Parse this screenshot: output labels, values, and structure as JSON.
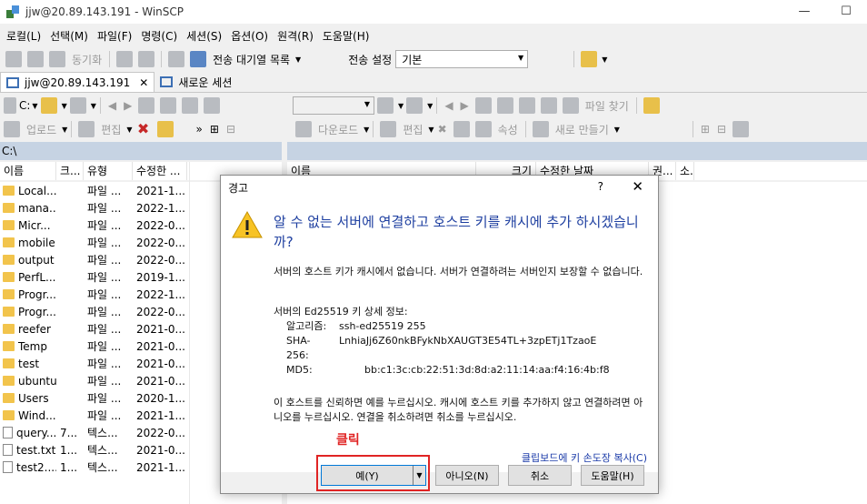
{
  "window": {
    "title": "jjw@20.89.143.191 - WinSCP",
    "minimize_glyph": "—",
    "maximize_glyph": "☐",
    "close_glyph": "✕"
  },
  "menu": [
    "로컬(L)",
    "선택(M)",
    "파일(F)",
    "명령(C)",
    "세션(S)",
    "옵션(O)",
    "원격(R)",
    "도움말(H)"
  ],
  "toolbar1": {
    "sync_label": "동기화",
    "queue_label": "전송 대기열 목록",
    "transfer_settings_label": "전송 설정",
    "transfer_settings_value": "기본"
  },
  "tabs": [
    {
      "label": "jjw@20.89.143.191",
      "close": "✕"
    },
    {
      "label": "새로운 세션"
    }
  ],
  "local_toolbar": {
    "drive": "C:",
    "upload_label": "업로드",
    "edit_label": "편집"
  },
  "remote_toolbar": {
    "find_files_label": "파일 찾기",
    "download_label": "다운로드",
    "edit_label": "편집",
    "properties_label": "속성",
    "new_label": "새로 만들기"
  },
  "local_panel": {
    "path": "C:\\",
    "columns": [
      "이름",
      "크...",
      "유형",
      "수정한 ..."
    ],
    "rows": [
      {
        "name": "Local...",
        "size": "",
        "type": "파일 ...",
        "date": "2021-1...",
        "icon": "folder"
      },
      {
        "name": "mana...",
        "size": "",
        "type": "파일 ...",
        "date": "2022-1...",
        "icon": "folder"
      },
      {
        "name": "Micr...",
        "size": "",
        "type": "파일 ...",
        "date": "2022-0...",
        "icon": "folder"
      },
      {
        "name": "mobile",
        "size": "",
        "type": "파일 ...",
        "date": "2022-0...",
        "icon": "folder"
      },
      {
        "name": "output",
        "size": "",
        "type": "파일 ...",
        "date": "2022-0...",
        "icon": "folder"
      },
      {
        "name": "PerfL...",
        "size": "",
        "type": "파일 ...",
        "date": "2019-1...",
        "icon": "folder"
      },
      {
        "name": "Progr...",
        "size": "",
        "type": "파일 ...",
        "date": "2022-1...",
        "icon": "folder"
      },
      {
        "name": "Progr...",
        "size": "",
        "type": "파일 ...",
        "date": "2022-0...",
        "icon": "folder"
      },
      {
        "name": "reefer",
        "size": "",
        "type": "파일 ...",
        "date": "2021-0...",
        "icon": "folder"
      },
      {
        "name": "Temp",
        "size": "",
        "type": "파일 ...",
        "date": "2021-0...",
        "icon": "folder"
      },
      {
        "name": "test",
        "size": "",
        "type": "파일 ...",
        "date": "2021-0...",
        "icon": "folder"
      },
      {
        "name": "ubuntu",
        "size": "",
        "type": "파일 ...",
        "date": "2021-0...",
        "icon": "folder"
      },
      {
        "name": "Users",
        "size": "",
        "type": "파일 ...",
        "date": "2020-1...",
        "icon": "folder"
      },
      {
        "name": "Wind...",
        "size": "",
        "type": "파일 ...",
        "date": "2021-1...",
        "icon": "folder"
      },
      {
        "name": "query...",
        "size": "7...",
        "type": "텍스...",
        "date": "2022-0...",
        "icon": "file"
      },
      {
        "name": "test.txt",
        "size": "1...",
        "type": "텍스...",
        "date": "2021-0...",
        "icon": "file"
      },
      {
        "name": "test2....",
        "size": "1...",
        "type": "텍스...",
        "date": "2021-1...",
        "icon": "file"
      }
    ]
  },
  "remote_panel": {
    "columns": [
      "이름",
      "크기",
      "수정한 날짜",
      "권...",
      "소."
    ]
  },
  "dialog": {
    "title": "경고",
    "help": "?",
    "close": "✕",
    "headline": "알 수 없는 서버에 연결하고 호스트 키를 캐시에 추가 하시겠습니까?",
    "para1": "서버의 호스트 키가 캐시에서 없습니다. 서버가 연결하려는 서버인지 보장할 수 없습니다.",
    "key_title": "서버의 Ed25519 키 상세 정보:",
    "details": [
      {
        "k": "알고리즘:",
        "v": "ssh-ed25519 255"
      },
      {
        "k": "SHA-256:",
        "v": "LnhiaJj6Z60nkBFykNbXAUGT3E54TL+3zpETj1TzaoE"
      },
      {
        "k": "MD5:",
        "v": "bb:c1:3c:cb:22:51:3d:8d:a2:11:14:aa:f4:16:4b:f8"
      }
    ],
    "para2": "이 호스트를 신뢰하면 예를 누르십시오. 캐시에 호스트 키를 추가하지 않고 연결하려면 아니오를 누르십시오. 연결을 취소하려면 취소를 누르십시오.",
    "copy_link": "클립보드에 키 손도장 복사(C)",
    "buttons": {
      "yes": "예(Y)",
      "no": "아니오(N)",
      "cancel": "취소",
      "help": "도움말(H)"
    }
  },
  "annotation": {
    "label": "클릭",
    "color": "#e02424"
  }
}
